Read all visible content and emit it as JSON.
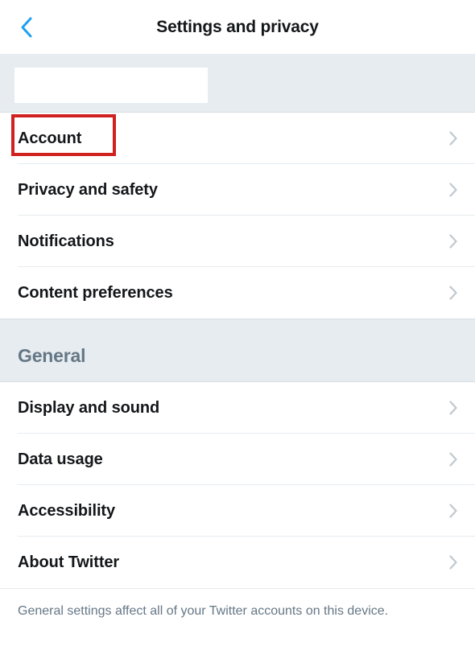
{
  "header": {
    "title": "Settings and privacy"
  },
  "section1": {
    "items": [
      {
        "label": "Account"
      },
      {
        "label": "Privacy and safety"
      },
      {
        "label": "Notifications"
      },
      {
        "label": "Content preferences"
      }
    ]
  },
  "section2": {
    "title": "General",
    "items": [
      {
        "label": "Display and sound"
      },
      {
        "label": "Data usage"
      },
      {
        "label": "Accessibility"
      },
      {
        "label": "About Twitter"
      }
    ],
    "footer": "General settings affect all of your Twitter accounts on this device."
  },
  "colors": {
    "accent": "#1da1f2"
  }
}
